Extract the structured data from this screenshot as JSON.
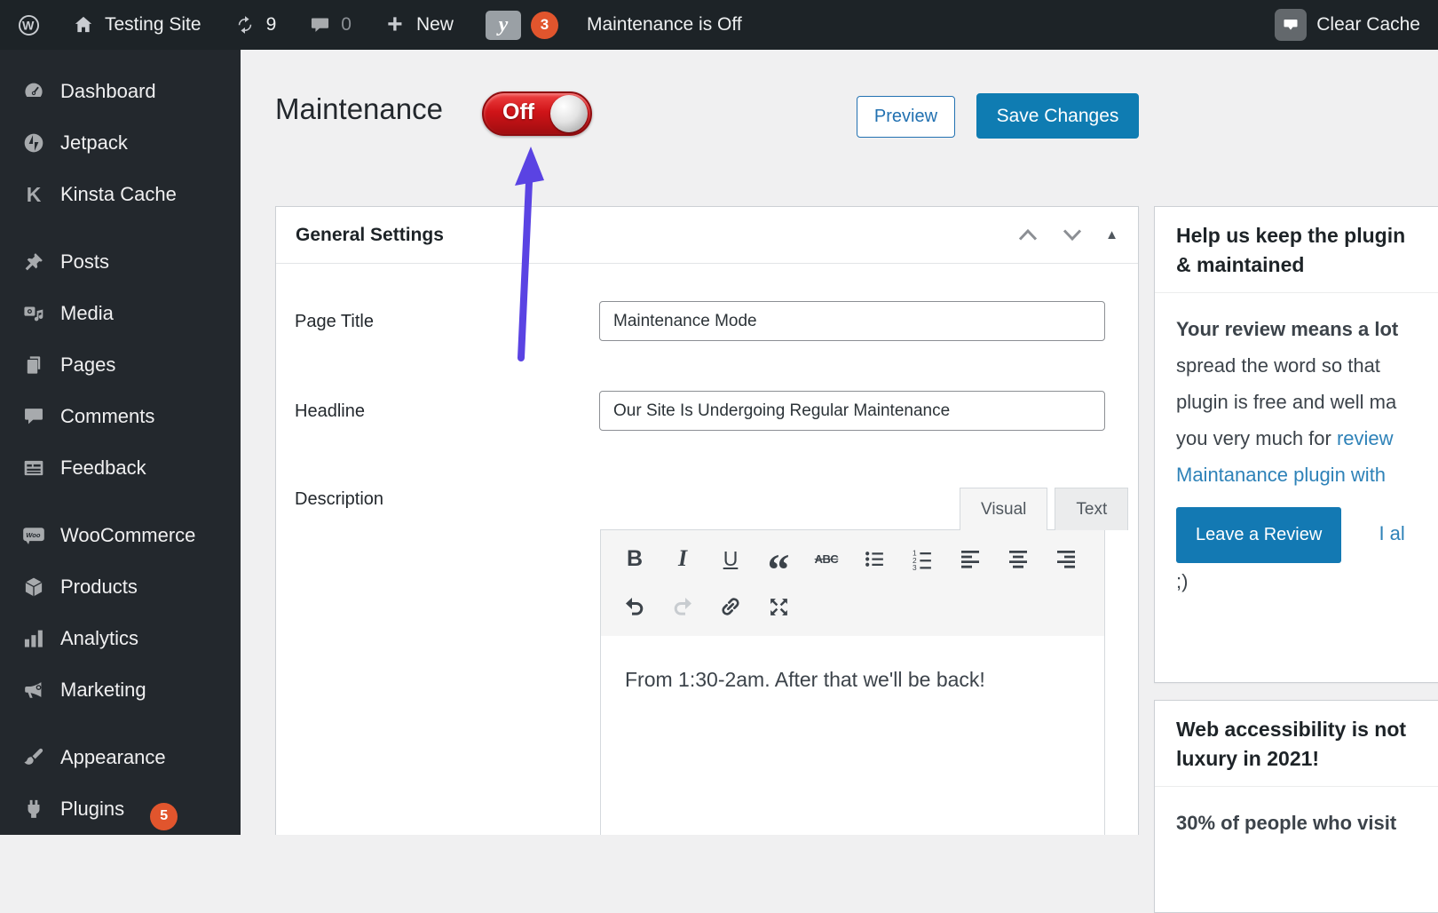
{
  "admin_bar": {
    "site_name": "Testing Site",
    "updates_count": "9",
    "comments_count": "0",
    "new_label": "New",
    "yoast_badge": "3",
    "status_text": "Maintenance is Off",
    "clear_cache_label": "Clear Cache"
  },
  "sidebar": {
    "items": [
      {
        "label": "Dashboard",
        "icon": "dashboard-gauge-icon"
      },
      {
        "label": "Jetpack",
        "icon": "jetpack-icon"
      },
      {
        "label": "Kinsta Cache",
        "icon": "kinsta-k-icon"
      },
      {
        "label": "Posts",
        "icon": "pushpin-icon"
      },
      {
        "label": "Media",
        "icon": "media-icon"
      },
      {
        "label": "Pages",
        "icon": "pages-icon"
      },
      {
        "label": "Comments",
        "icon": "comment-bubble-icon"
      },
      {
        "label": "Feedback",
        "icon": "feedback-form-icon"
      },
      {
        "label": "WooCommerce",
        "icon": "woocommerce-icon"
      },
      {
        "label": "Products",
        "icon": "product-box-icon"
      },
      {
        "label": "Analytics",
        "icon": "bar-chart-icon"
      },
      {
        "label": "Marketing",
        "icon": "megaphone-icon"
      },
      {
        "label": "Appearance",
        "icon": "paintbrush-icon"
      },
      {
        "label": "Plugins",
        "icon": "plug-icon",
        "badge": "5"
      }
    ]
  },
  "page": {
    "title": "Maintenance",
    "toggle_state": "Off",
    "preview_label": "Preview",
    "save_label": "Save Changes"
  },
  "settings_panel": {
    "title": "General Settings",
    "page_title_label": "Page Title",
    "page_title_value": "Maintenance Mode",
    "headline_label": "Headline",
    "headline_value": "Our Site Is Undergoing Regular Maintenance",
    "description_label": "Description",
    "tabs": {
      "visual": "Visual",
      "text": "Text"
    },
    "toolbar_icons": [
      "bold",
      "italic",
      "underline",
      "blockquote",
      "strikethrough",
      "bulleted-list",
      "numbered-list",
      "align-left",
      "align-center",
      "align-right",
      "undo",
      "redo",
      "link",
      "fullscreen"
    ],
    "editor_content": "From 1:30-2am. After that we'll be back!"
  },
  "review_panel": {
    "heading": "Help us keep the plugin\n& maintained",
    "intro_bold": "Your review means a lot",
    "line2": "spread the word so that",
    "line3": "plugin is free and well ma",
    "line4_text": "you very much for ",
    "line4_link": "review",
    "line5_link": "Maintanance plugin with",
    "button_label": "Leave a Review",
    "aside_link": "I al",
    "smiley": ";)"
  },
  "accessibility_panel": {
    "heading": "Web accessibility is not\nluxury in 2021!",
    "body": "30% of people who visit"
  },
  "colors": {
    "admin_bar_bg": "#1d2327",
    "sidebar_bg": "#23282d",
    "accent_blue": "#0f7cb2",
    "link_blue": "#2e82b8",
    "badge_orange": "#e1552d",
    "toggle_red": "#d01418",
    "arrow_purple": "#5a43e3",
    "page_bg": "#f0f0f1"
  }
}
